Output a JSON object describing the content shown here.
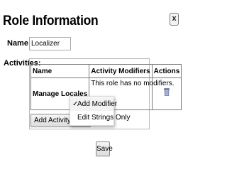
{
  "dialog": {
    "title": "Role Information",
    "close_label": "x"
  },
  "form": {
    "name_label": "Name:",
    "name_value": "Localizer",
    "activities_label": "Activities:"
  },
  "table": {
    "headers": [
      "Name",
      "Activity Modifiers",
      "Actions"
    ],
    "rows": [
      {
        "name": "Manage Locales",
        "modifiers": "This role has no modifiers.",
        "action_icon": "trash-icon"
      }
    ]
  },
  "add_activity_button": "Add Activity Role",
  "context_menu": {
    "items": [
      {
        "label": "Add Modifier",
        "checked": true,
        "check_mark": "✓"
      },
      {
        "label": "Edit Strings Only",
        "checked": false
      }
    ]
  },
  "save_button": "Save",
  "colors": {
    "background": "#ffffff",
    "border": "#7a7a7a"
  }
}
